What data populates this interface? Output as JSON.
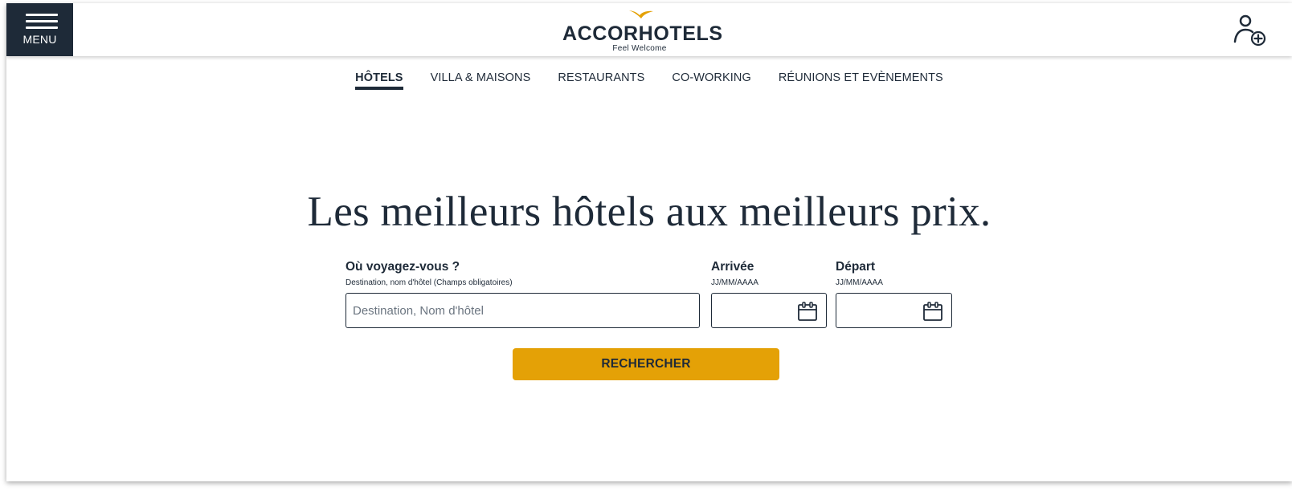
{
  "header": {
    "menu_label": "MENU",
    "brand_name": "ACCORHOTELS",
    "brand_tagline": "Feel Welcome",
    "brand_color": "#e4a106"
  },
  "tabs": [
    {
      "label": "HÔTELS",
      "active": true
    },
    {
      "label": "VILLA & MAISONS",
      "active": false
    },
    {
      "label": "RESTAURANTS",
      "active": false
    },
    {
      "label": "CO-WORKING",
      "active": false
    },
    {
      "label": "RÉUNIONS ET EVÈNEMENTS",
      "active": false
    }
  ],
  "hero": {
    "title": "Les meilleurs hôtels aux meilleurs prix."
  },
  "search": {
    "destination": {
      "label": "Où voyagez-vous ?",
      "hint": "Destination, nom d'hôtel (Champs obligatoires)",
      "placeholder": "Destination, Nom d'hôtel",
      "value": ""
    },
    "arrival": {
      "label": "Arrivée",
      "hint": "JJ/MM/AAAA",
      "value": ""
    },
    "departure": {
      "label": "Départ",
      "hint": "JJ/MM/AAAA",
      "value": ""
    },
    "submit_label": "RECHERCHER"
  },
  "colors": {
    "navy": "#1e2a38",
    "accent": "#e4a106"
  }
}
